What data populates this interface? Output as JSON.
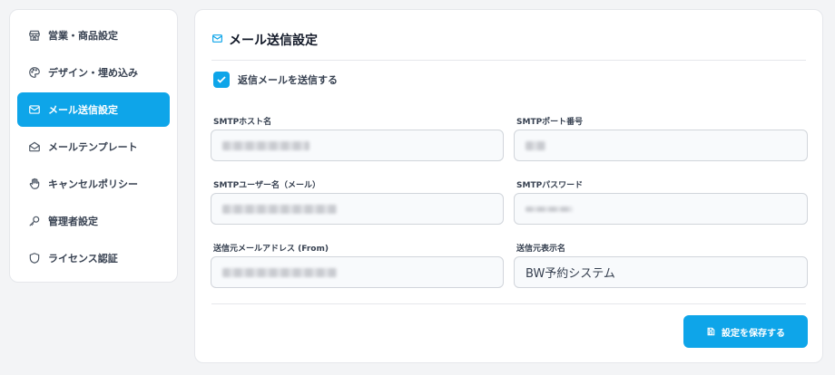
{
  "sidebar": {
    "items": [
      {
        "label": "営業・商品設定",
        "icon": "store-icon"
      },
      {
        "label": "デザイン・埋め込み",
        "icon": "palette-icon"
      },
      {
        "label": "メール送信設定",
        "icon": "mail-icon"
      },
      {
        "label": "メールテンプレート",
        "icon": "mail-open-icon"
      },
      {
        "label": "キャンセルポリシー",
        "icon": "hand-icon"
      },
      {
        "label": "管理者設定",
        "icon": "key-icon"
      },
      {
        "label": "ライセンス認証",
        "icon": "shield-icon"
      }
    ],
    "active_index": 2
  },
  "main": {
    "title": "メール送信設定",
    "reply_checkbox": {
      "label": "返信メールを送信する",
      "checked": true
    },
    "fields": {
      "smtp_host": {
        "label": "SMTPホスト名",
        "value": ""
      },
      "smtp_port": {
        "label": "SMTPポート番号",
        "value": ""
      },
      "smtp_user": {
        "label": "SMTPユーザー名（メール）",
        "value": ""
      },
      "smtp_password": {
        "label": "SMTPパスワード",
        "value": ""
      },
      "from_address": {
        "label": "送信元メールアドレス (From)",
        "value": ""
      },
      "from_name": {
        "label": "送信元表示名",
        "value": "BW予約システム"
      }
    },
    "save_label": "設定を保存する"
  },
  "colors": {
    "accent": "#0ea5e9",
    "background": "#f3f4f6"
  }
}
